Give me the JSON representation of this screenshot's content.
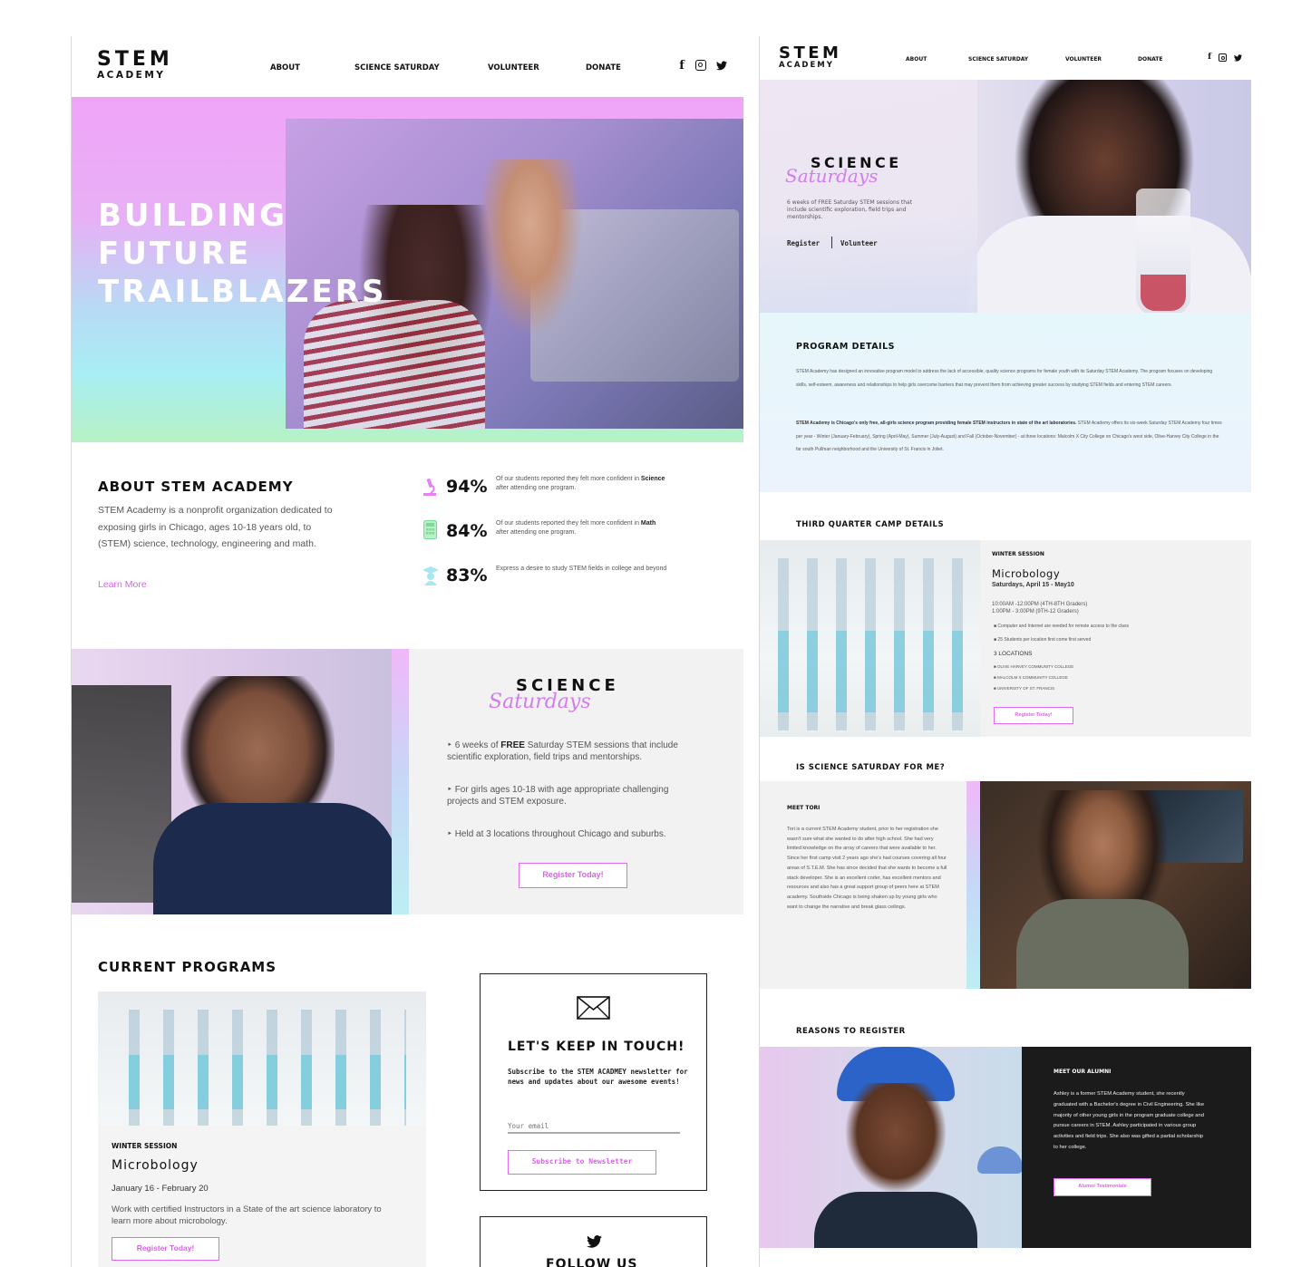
{
  "left": {
    "logo": {
      "top": "STEM",
      "bottom": "ACADEMY"
    },
    "nav": [
      "ABOUT",
      "SCIENCE SATURDAY",
      "VOLUNTEER",
      "DONATE"
    ],
    "social": [
      "f",
      "◎",
      "🐦"
    ],
    "hero": {
      "lines": [
        "BUILDING",
        "FUTURE",
        "TRAILBLAZERS"
      ]
    },
    "about": {
      "title": "ABOUT STEM ACADEMY",
      "text": "STEM Academy is a nonprofit organization dedicated to exposing girls in Chicago, ages 10-18 years old, to (STEM) science, technology, engineering and math.",
      "link": "Learn More",
      "stats": [
        {
          "pct": "94%",
          "pre": "Of our students reported they felt more confident in ",
          "bold": "Science",
          "post": " after attending one program."
        },
        {
          "pct": "84%",
          "pre": "Of our students reported they felt more confident in ",
          "bold": "Math",
          "post": " after attending one program."
        },
        {
          "pct": "83%",
          "pre": "Express a desire to study STEM fields in college and beyond",
          "bold": "",
          "post": ""
        }
      ]
    },
    "science": {
      "title": "SCIENCE",
      "script": "Saturdays",
      "bullets": [
        {
          "pre": "6 weeks of ",
          "bold": "FREE",
          "post": " Saturday STEM sessions that include scientific exploration, field trips and mentorships."
        },
        {
          "pre": "For girls ages 10-18 with age appropriate challenging projects and STEM exposure.",
          "bold": "",
          "post": ""
        },
        {
          "pre": "Held at 3 locations throughout Chicago and suburbs.",
          "bold": "",
          "post": ""
        }
      ],
      "button": "Register Today!"
    },
    "programs": {
      "title": "CURRENT PROGRAMS",
      "session": "WINTER SESSION",
      "name": "Microbology",
      "dates": "January 16 - February 20",
      "desc": "Work with certified Instructors in a State of the art science laboratory to learn more about microbology.",
      "button": "Register Today!"
    },
    "newsletter": {
      "title": "LET'S KEEP IN TOUCH!",
      "text": "Subscribe to the STEM ACADMEY newsletter for news and updates about our awesome events!",
      "placeholder": "Your email",
      "button": "Subscribe to Newsletter"
    },
    "follow": {
      "title": "FOLLOW US"
    }
  },
  "right": {
    "logo": {
      "top": "STEM",
      "bottom": "ACADEMY"
    },
    "nav": [
      "ABOUT",
      "SCIENCE SATURDAY",
      "VOLUNTEER",
      "DONATE"
    ],
    "social": [
      "f",
      "◎",
      "🐦"
    ],
    "hero": {
      "title": "SCIENCE",
      "script": "Saturdays",
      "text": "6 weeks of FREE Saturday STEM sessions that include scientific exploration, field trips and mentorships.",
      "register": "Register",
      "volunteer": "Volunteer"
    },
    "program": {
      "title": "PROGRAM DETAILS",
      "p1": "STEM Academy has designed an innovative program model to address the lack of accessible, quality science programs for female youth with its Saturday STEM Academy. The program focuses on developing skills, self-esteem, awareness and relationships to help girls overcome barriers that may prevent them from achieving greater success by studying STEM fields and entering STEM careers.",
      "p2bold": "STEM Academy is Chicago's only free, all-girls science program providing female STEM instructors in state of the art laboratories.",
      "p2": " STEM Academy offers its six-week Saturday STEM Academy four times per year - Winter (January-February), Spring (April-May), Summer (July-August) and Fall (October-November) - at three locations: Malcolm X City College on Chicago's west side, Olive-Harvey City College in the far south Pullman neighborhood and the University of St. Francis in Joliet."
    },
    "camp": {
      "title": "THIRD QUARTER CAMP DETAILS",
      "session": "WINTER SESSION",
      "name": "Microbology",
      "dates": "Saturdays, April 15 - May10",
      "times": [
        "10:00AM -12:00PM (4TH-8TH Graders)",
        "1:00PM - 3:00PM (9TH-12 Graders)"
      ],
      "notes": [
        "Computer and Internet are needed for remote access to the class",
        "25 Students per location first come first served"
      ],
      "loc_title": "3 LOCATIONS",
      "locations": [
        "OLIVE HARVEY COMMUNITY COLLEGE",
        "MALCOLM X COMMUNITY COLLEGE",
        "UNIVERSITY OF ST. FRANCIS"
      ],
      "button": "Register Today!"
    },
    "forme": {
      "title": "IS SCIENCE SATURDAY FOR ME?",
      "meet": "MEET TORI",
      "text": "Tori is a current STEM Academy student, prior to her registration she wasn't sure what she wanted to do after high school. She had very limited knowledge on the array of careers that were available to her. Since her first camp visit 2 years ago she's had courses covering all four areas of S.T.E.M. She has since decided that she wants to become a full stack developer. She is an excellent coder, has excellent mentors and resources and also has a great support group of peers here at STEM academy. Southside Chicago is being shaken up by young girls who want to change the narrative and break glass ceilings."
    },
    "reasons": {
      "title": "REASONS TO REGISTER",
      "meet": "MEET OUR ALUMNI",
      "text": "Ashley is a former STEM Academy student, she recently graduated with a Bachelor's degree in Civil Engineering. She like majority of other young girls in the program graduate college and pursue careers in STEM. Ashley participated in various group activities and field trips. She also was gifted a partial scholarship to her college.",
      "button": "Alumni Testimonials"
    }
  }
}
